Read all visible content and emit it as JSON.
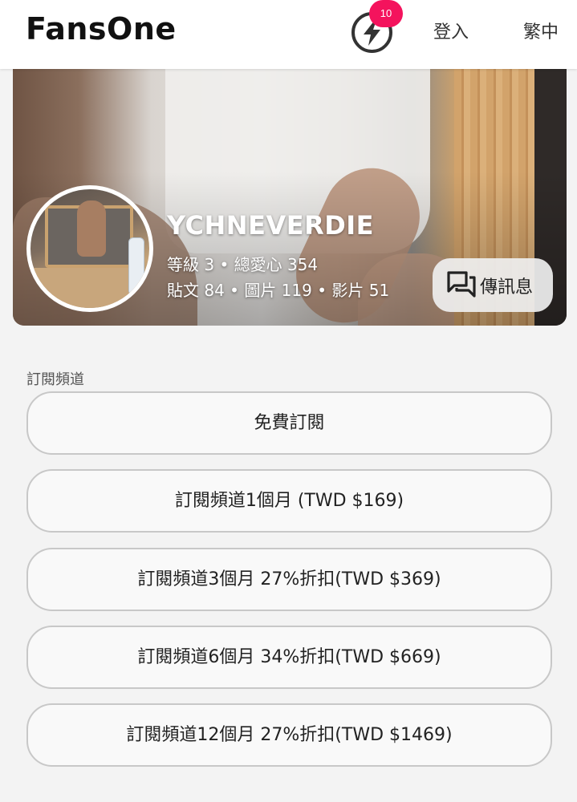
{
  "header": {
    "logo": "FansOne",
    "notification_count": "10",
    "login_label": "登入",
    "language_label": "繁中"
  },
  "profile": {
    "name": "YCHNEVERDIE",
    "stats_line_1": "等級 3 • 總愛心 354",
    "stats_line_2": "貼文 84 • 圖片 119 • 影片 51",
    "message_label": "傳訊息"
  },
  "subscriptions": {
    "section_label": "訂閱頻道",
    "options": [
      {
        "label": "免費訂閱"
      },
      {
        "label": "訂閱頻道1個月 (TWD $169)"
      },
      {
        "label": "訂閱頻道3個月 27%折扣(TWD $369)"
      },
      {
        "label": "訂閱頻道6個月 34%折扣(TWD $669)"
      },
      {
        "label": "訂閱頻道12個月 27%折扣(TWD $1469)"
      }
    ]
  },
  "colors": {
    "badge": "#f4135d",
    "page_background": "#f3f3f3",
    "button_border": "#c8c8c8"
  },
  "icons": {
    "notification": "lightning-bolt-icon",
    "message": "chat-bubbles-icon"
  }
}
